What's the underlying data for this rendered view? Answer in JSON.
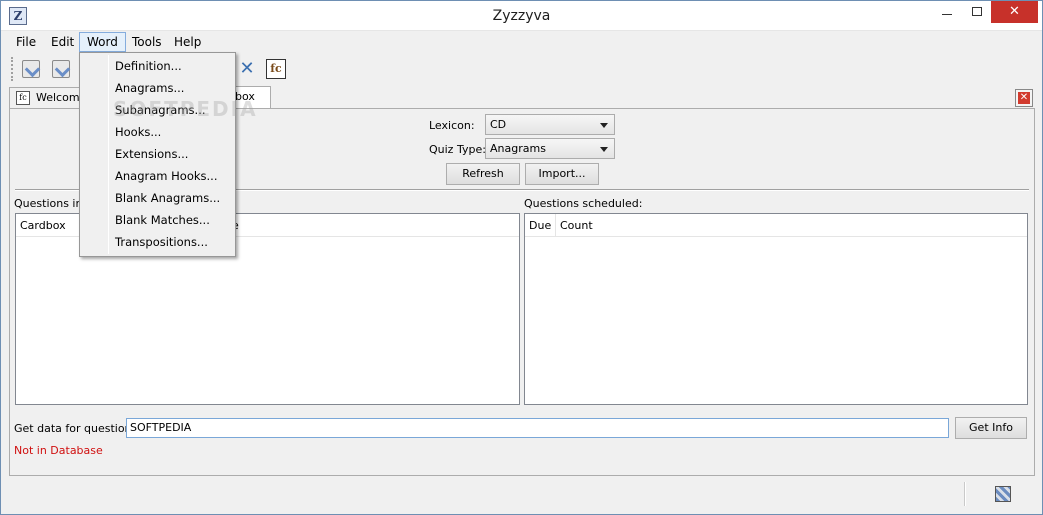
{
  "window": {
    "title": "Zyzzyva",
    "app_icon_letter": "Z",
    "close_glyph": "✕"
  },
  "menubar": {
    "items": [
      "File",
      "Edit",
      "Word",
      "Tools",
      "Help"
    ],
    "active": "Word"
  },
  "word_menu": {
    "items": [
      "Definition...",
      "Anagrams...",
      "Subanagrams...",
      "Hooks...",
      "Extensions...",
      "Anagram Hooks...",
      "Blank Anagrams...",
      "Blank Matches...",
      "Transpositions..."
    ]
  },
  "toolbar": {
    "icons": [
      "open-quiz-icon",
      "save-quiz-icon",
      "settings-wrench-icon",
      "cardbox-icon"
    ],
    "cardbox_letter": "fc"
  },
  "tabs": {
    "items": [
      {
        "label": "Welcome",
        "icon": "fc"
      },
      {
        "label": "dbox",
        "icon": "fc"
      }
    ],
    "selected": 1
  },
  "cardbox": {
    "lexicon_label": "Lexicon:",
    "lexicon_value": "CD",
    "quiz_type_label": "Quiz Type:",
    "quiz_type_value": "Anagrams",
    "refresh_label": "Refresh",
    "import_label": "Import...",
    "questions_in_label": "Questions in e",
    "left_columns": [
      "Cardbox",
      "e"
    ],
    "questions_scheduled_label": "Questions scheduled:",
    "right_columns": [
      "Due",
      "Count"
    ],
    "get_data_label": "Get data for question:",
    "question_value": "SOFTPEDIA",
    "get_info_label": "Get Info",
    "status_text": "Not in Database",
    "status_color": "#d01010"
  },
  "watermark": "SOFTPEDIA"
}
